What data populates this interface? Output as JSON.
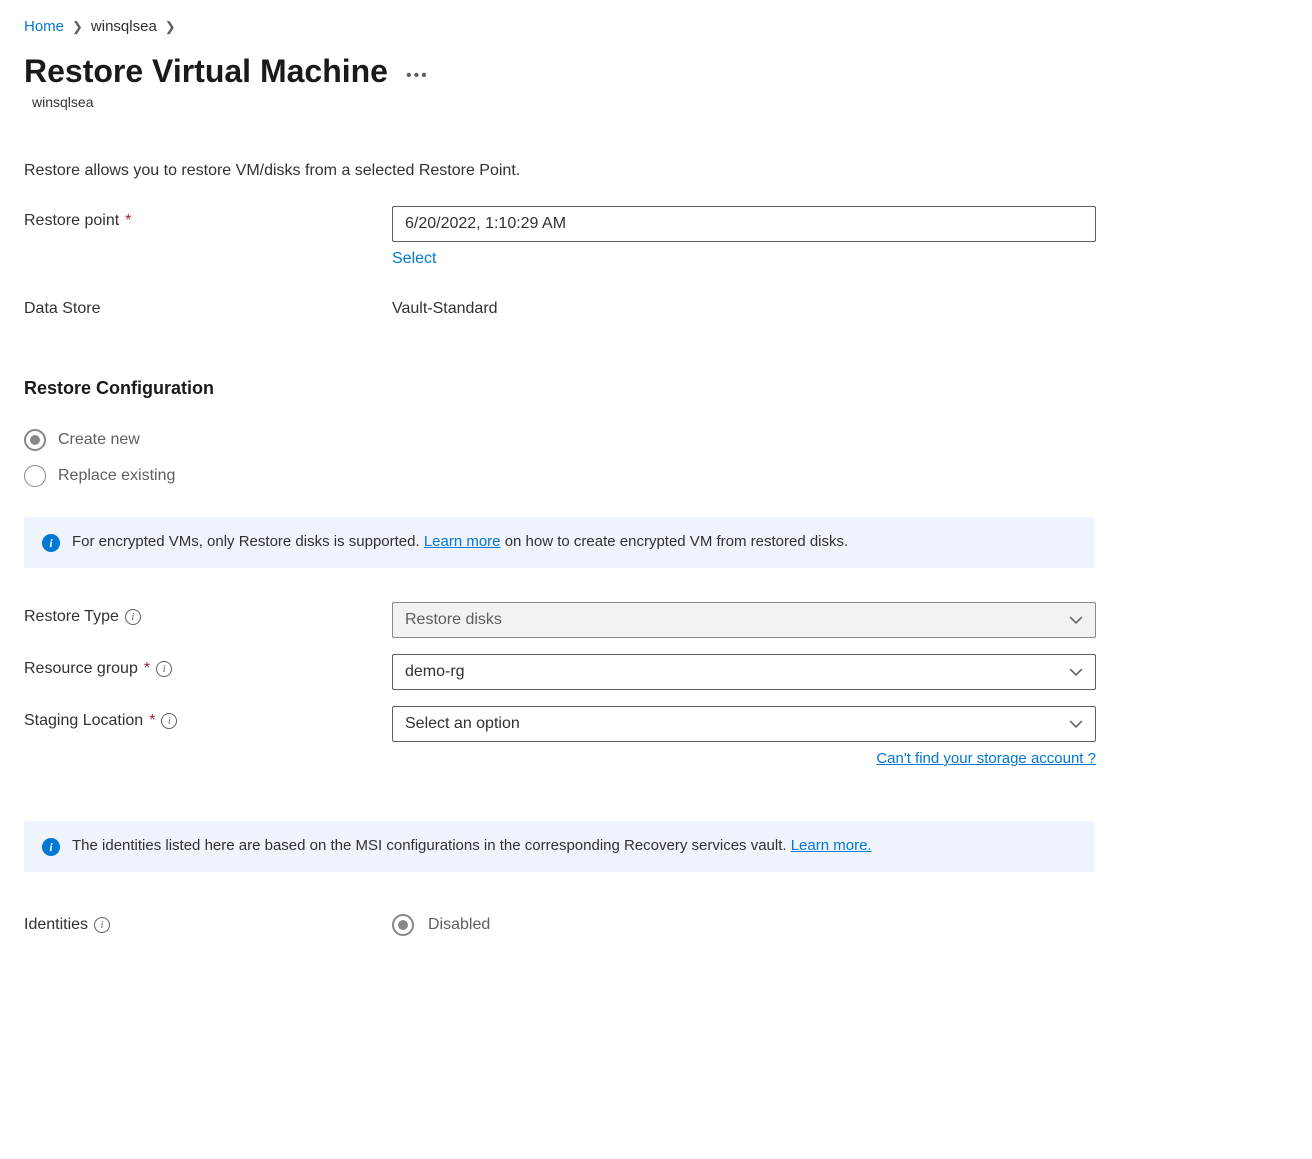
{
  "breadcrumb": {
    "home": "Home",
    "item": "winsqlsea"
  },
  "page": {
    "title": "Restore Virtual Machine",
    "subtitle": "winsqlsea",
    "description": "Restore allows you to restore VM/disks from a selected Restore Point."
  },
  "restorePoint": {
    "label": "Restore point",
    "value": "6/20/2022, 1:10:29 AM",
    "selectLink": "Select"
  },
  "dataStore": {
    "label": "Data Store",
    "value": "Vault-Standard"
  },
  "restoreConfig": {
    "heading": "Restore Configuration",
    "options": {
      "createNew": "Create new",
      "replaceExisting": "Replace existing"
    }
  },
  "infoBanner1": {
    "textBefore": "For encrypted VMs, only Restore disks is supported. ",
    "link": "Learn more",
    "textAfter": " on how to create encrypted VM from restored disks."
  },
  "restoreType": {
    "label": "Restore Type",
    "value": "Restore disks"
  },
  "resourceGroup": {
    "label": "Resource group",
    "value": "demo-rg"
  },
  "stagingLocation": {
    "label": "Staging Location",
    "placeholder": "Select an option",
    "helperLink": "Can't find your storage account ?"
  },
  "infoBanner2": {
    "textBefore": "The identities listed here are based on the MSI configurations in the corresponding Recovery services vault. ",
    "link": "Learn more."
  },
  "identities": {
    "label": "Identities",
    "value": "Disabled"
  }
}
